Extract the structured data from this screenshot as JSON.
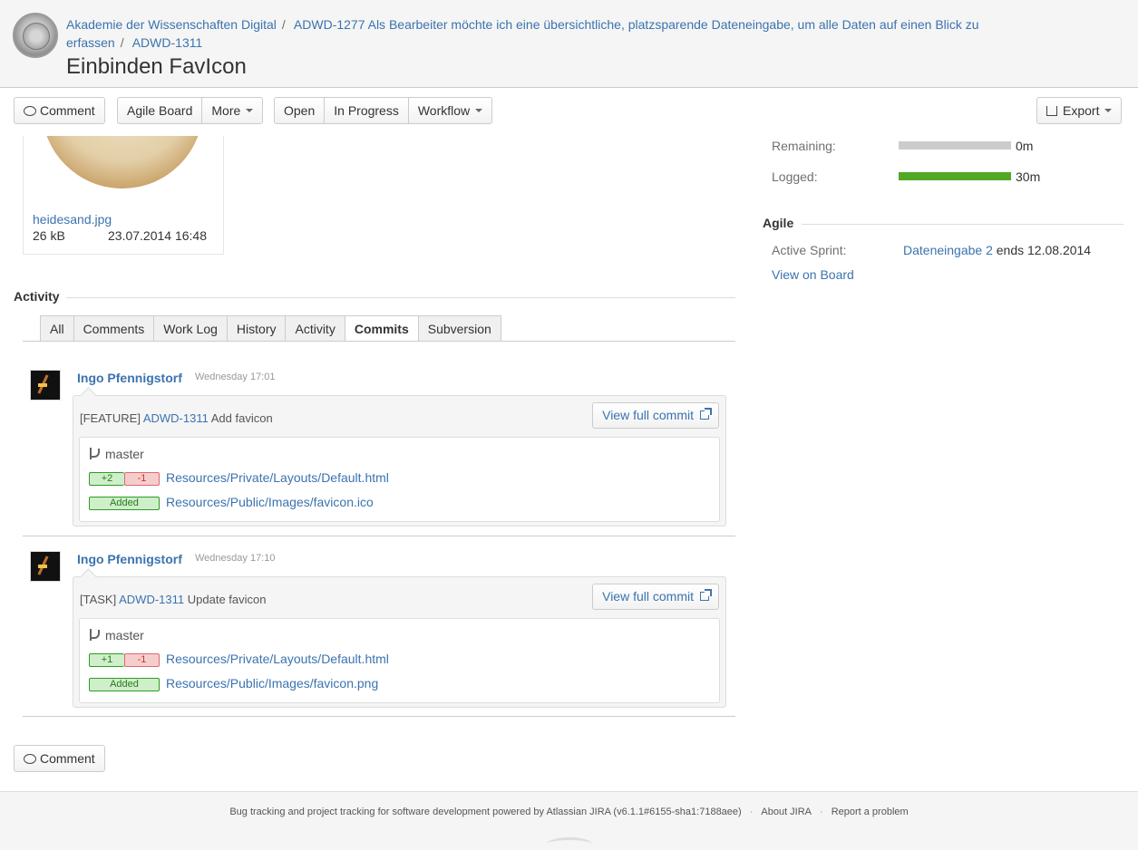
{
  "header": {
    "breadcrumbs": [
      "Akademie der Wissenschaften Digital",
      "ADWD-1277 Als Bearbeiter möchte ich eine übersichtliche, platzsparende Dateneingabe, um alle Daten auf einen Blick zu erfassen",
      "ADWD-1311"
    ],
    "title": "Einbinden FavIcon"
  },
  "toolbar": {
    "comment": "Comment",
    "agile_board": "Agile Board",
    "more": "More",
    "open": "Open",
    "in_progress": "In Progress",
    "workflow": "Workflow",
    "export": "Export"
  },
  "attachment": {
    "name": "heidesand.jpg",
    "size": "26 kB",
    "date": "23.07.2014 16:48"
  },
  "time_tracking": {
    "remaining_label": "Remaining:",
    "remaining_value": "0m",
    "remaining_fraction": 0,
    "logged_label": "Logged:",
    "logged_value": "30m",
    "logged_fraction": 1,
    "colors": {
      "remaining": "#cccccc",
      "logged": "#51a825"
    }
  },
  "agile": {
    "heading": "Agile",
    "active_sprint_label": "Active Sprint:",
    "sprint_name": "Dateneingabe 2",
    "sprint_ends": "ends 12.08.2014",
    "view_on_board": "View on Board"
  },
  "activity": {
    "heading": "Activity",
    "tabs": [
      "All",
      "Comments",
      "Work Log",
      "History",
      "Activity",
      "Commits",
      "Subversion"
    ],
    "active_tab": "Commits"
  },
  "commits": [
    {
      "author": "Ingo Pfennigstorf",
      "time": "Wednesday 17:01",
      "prefix": "[FEATURE]",
      "issue": "ADWD-1311",
      "message": "Add favicon",
      "view_full_commit": "View full commit",
      "branch": "master",
      "files": [
        {
          "plus": "+2",
          "minus": "-1",
          "path": "Resources/Private/Layouts/Default.html"
        },
        {
          "added": "Added",
          "path": "Resources/Public/Images/favicon.ico"
        }
      ]
    },
    {
      "author": "Ingo Pfennigstorf",
      "time": "Wednesday 17:10",
      "prefix": "[TASK]",
      "issue": "ADWD-1311",
      "message": "Update favicon",
      "view_full_commit": "View full commit",
      "branch": "master",
      "files": [
        {
          "plus": "+1",
          "minus": "-1",
          "path": "Resources/Private/Layouts/Default.html"
        },
        {
          "added": "Added",
          "path": "Resources/Public/Images/favicon.png"
        }
      ]
    }
  ],
  "bottom": {
    "comment": "Comment"
  },
  "footer": {
    "text": "Bug tracking and project tracking for software development powered by Atlassian JIRA (v6.1.1#6155-sha1:7188aee)",
    "about": "About JIRA",
    "report": "Report a problem"
  },
  "colors": {
    "link": "#3b73af",
    "header_bg": "#f5f5f5"
  }
}
